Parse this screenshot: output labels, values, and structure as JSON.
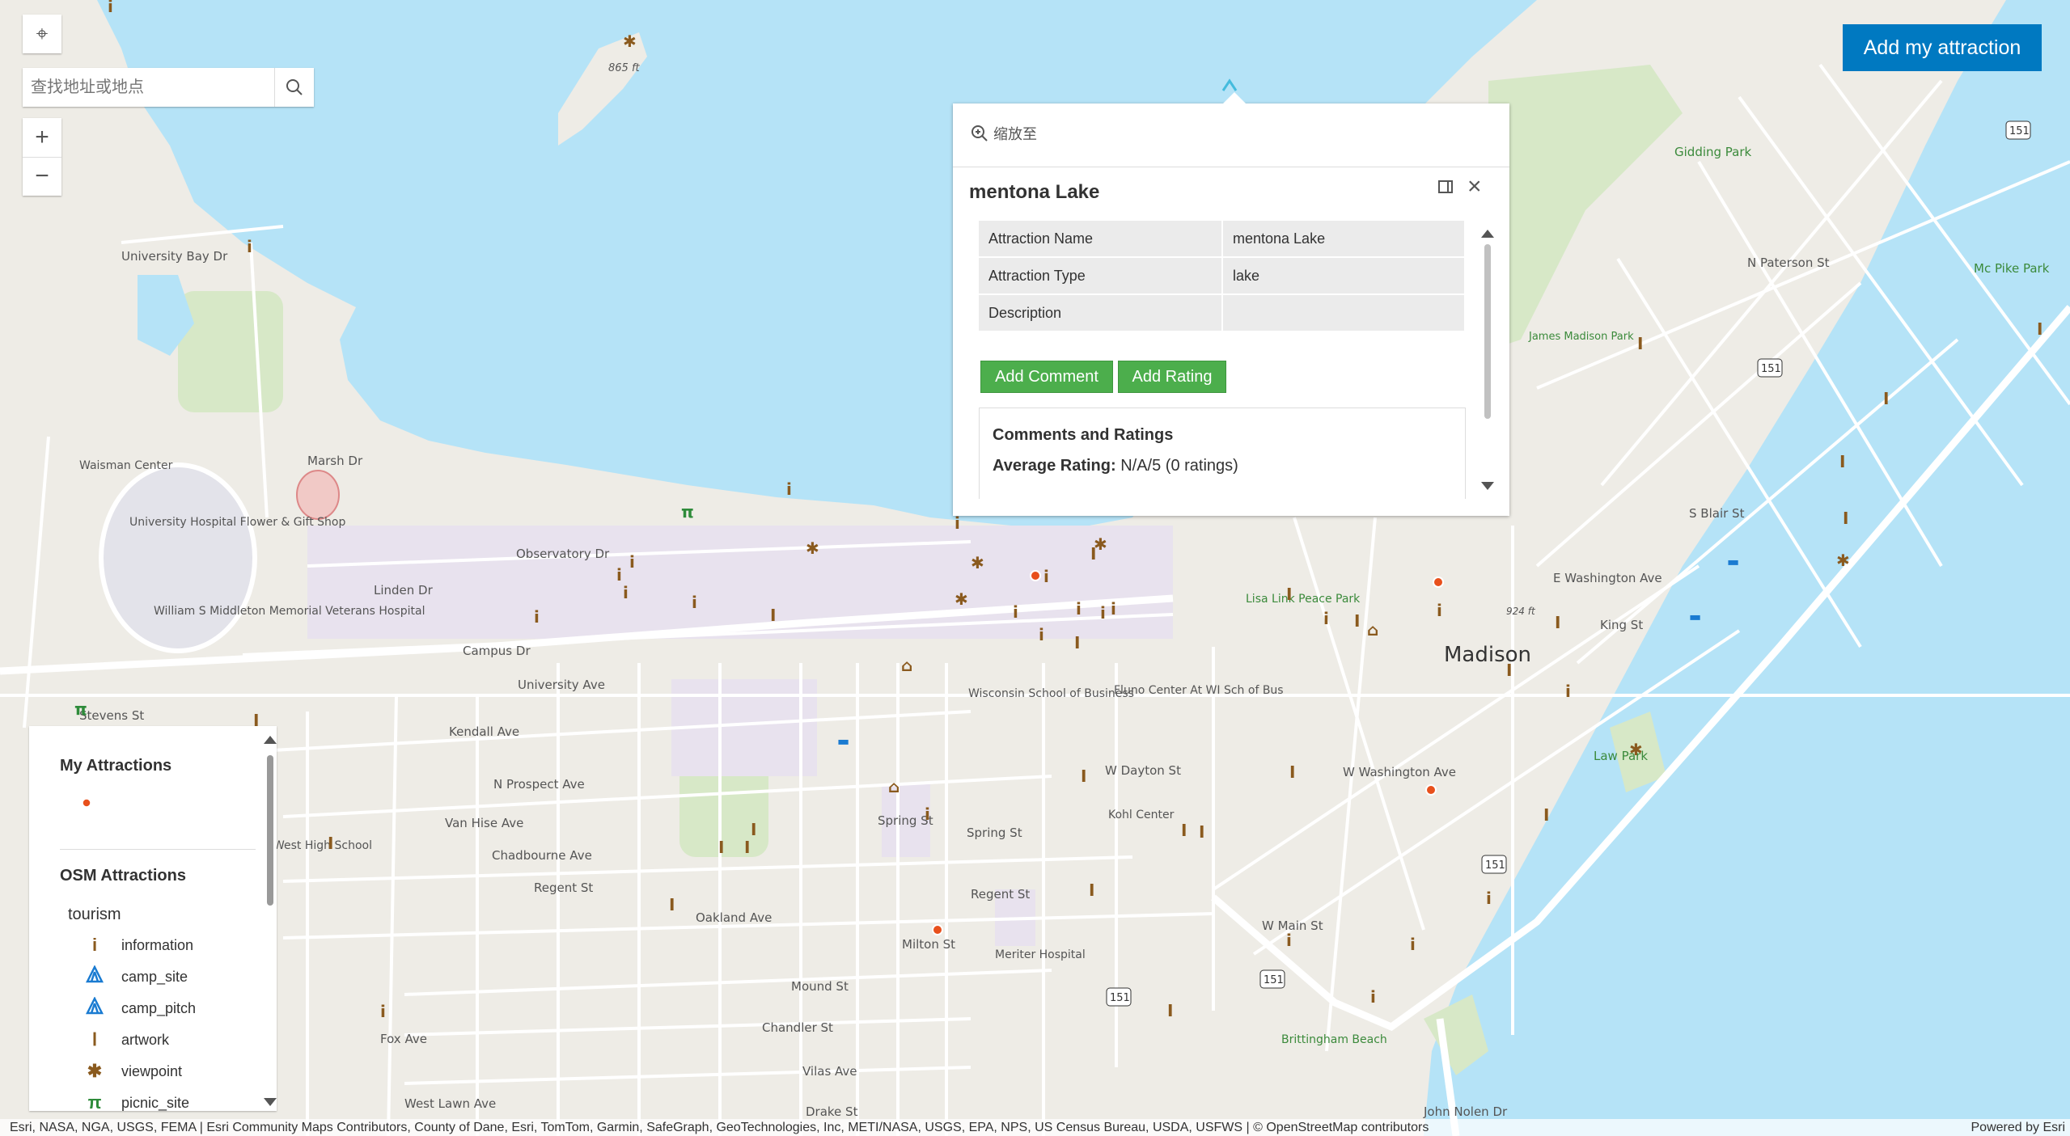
{
  "map": {
    "labels": {
      "madison": "Madison",
      "gidding_park": "Gidding Park",
      "james_madison_park": "James Madison Park",
      "mc_pike_park": "Mc Pike Park",
      "lisa_link": "Lisa Link Peace Park",
      "law_park": "Law Park",
      "brittingham": "Brittingham Beach",
      "waisman": "Waisman Center",
      "hospital_flower": "University Hospital Flower & Gift Shop",
      "middleton": "William S Middleton Memorial Veterans Hospital",
      "wi_school_business": "Wisconsin School of Business",
      "fluno": "Fluno Center At WI Sch of Bus",
      "kohl": "Kohl Center",
      "meriter": "Meriter Hospital",
      "west_high": "West High School",
      "elev_865": "865 ft",
      "elev_924": "924 ft",
      "marsh_dr": "Marsh Dr",
      "observatory_dr": "Observatory Dr",
      "linden_dr": "Linden Dr",
      "campus_dr": "Campus Dr",
      "university_ave": "University Ave",
      "university_bay_dr": "University Bay Dr",
      "kendall_ave": "Kendall Ave",
      "n_prospect": "N Prospect Ave",
      "van_hise": "Van Hise Ave",
      "chadbourne": "Chadbourne Ave",
      "regent_st": "Regent St",
      "spring_st": "Spring St",
      "milton_st": "Milton St",
      "mound_st": "Mound St",
      "chandler_st": "Chandler St",
      "vilas_ave": "Vilas Ave",
      "drake_st": "Drake St",
      "w_dayton": "W Dayton St",
      "king_st": "King St",
      "stevens_st": "Stevens St",
      "oakland_ave": "Oakland Ave",
      "fox_ave": "Fox Ave",
      "west_lawn": "West Lawn Ave",
      "w_main_st": "W Main St",
      "e_washington": "E Washington Ave",
      "w_washington": "W Washington Ave",
      "s_blair": "S Blair St",
      "n_paterson": "N Paterson St",
      "john_nolen": "John Nolen Dr",
      "us151": "151"
    }
  },
  "search": {
    "placeholder": "查找地址或地点"
  },
  "add_attraction_button": "Add my attraction",
  "popup": {
    "zoom_to": "缩放至",
    "title": "mentona Lake",
    "fields": [
      {
        "name": "Attraction Name",
        "value": "mentona Lake"
      },
      {
        "name": "Attraction Type",
        "value": "lake"
      },
      {
        "name": "Description",
        "value": ""
      }
    ],
    "add_comment": "Add Comment",
    "add_rating": "Add Rating",
    "comments_title": "Comments and Ratings",
    "average_label": "Average Rating:",
    "average_value": "N/A/5 (0 ratings)"
  },
  "legend": {
    "my_attractions": "My Attractions",
    "osm_attractions": "OSM Attractions",
    "tourism": "tourism",
    "items": [
      {
        "label": "information",
        "icon": "information-icon",
        "glyph": "i",
        "color": "#8a5a1e"
      },
      {
        "label": "camp_site",
        "icon": "camp-site-icon",
        "glyph": "⛺",
        "color": "#1a7bd1"
      },
      {
        "label": "camp_pitch",
        "icon": "camp-pitch-icon",
        "glyph": "⛺",
        "color": "#1a7bd1"
      },
      {
        "label": "artwork",
        "icon": "artwork-icon",
        "glyph": "Ⅰ",
        "color": "#8a5a1e"
      },
      {
        "label": "viewpoint",
        "icon": "viewpoint-icon",
        "glyph": "✱",
        "color": "#8a5a1e"
      },
      {
        "label": "picnic_site",
        "icon": "picnic-site-icon",
        "glyph": "π",
        "color": "#2e8b3a"
      }
    ]
  },
  "attribution": {
    "text": "Esri, NASA, NGA, USGS, FEMA | Esri Community Maps Contributors, County of Dane, Esri, TomTom, Garmin, SafeGraph, GeoTechnologies, Inc, METI/NASA, USGS, EPA, NPS, US Census Bureau, USDA, USFWS | © OpenStreetMap contributors",
    "powered_by": "Powered by Esri"
  },
  "colors": {
    "water": "#b5e3f7",
    "land": "#eeece6",
    "park": "#d7e8c7",
    "campus": "#e8e2ee",
    "accent": "#0079c1",
    "button_green": "#4cae4c",
    "poi_brown": "#8a5a1e",
    "my_attraction": "#e8501c"
  }
}
